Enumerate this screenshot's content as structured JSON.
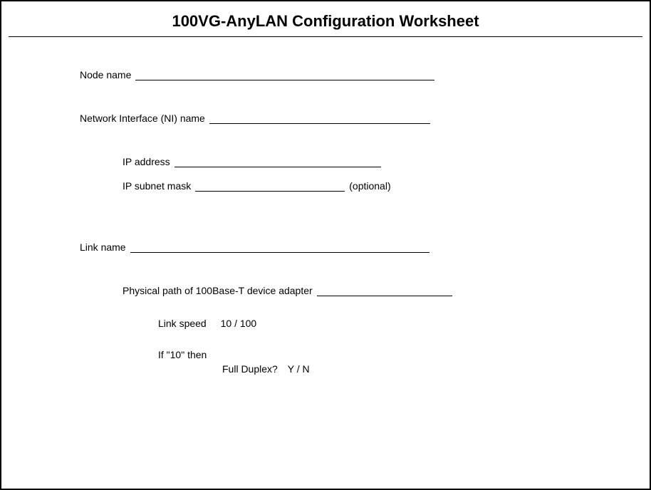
{
  "title": "100VG-AnyLAN Configuration Worksheet",
  "fields": {
    "node_name_label": "Node name",
    "ni_name_label": "Network Interface (NI) name",
    "ip_address_label": "IP address",
    "ip_subnet_label": "IP subnet mask",
    "ip_subnet_suffix": "(optional)",
    "link_name_label": "Link name",
    "physical_path_label": "Physical path of 100Base-T device adapter",
    "link_speed_label": "Link speed",
    "link_speed_value": "10 / 100",
    "if10_label": "If \"10\" then",
    "full_duplex_label": "Full Duplex?",
    "full_duplex_value": "Y / N"
  }
}
